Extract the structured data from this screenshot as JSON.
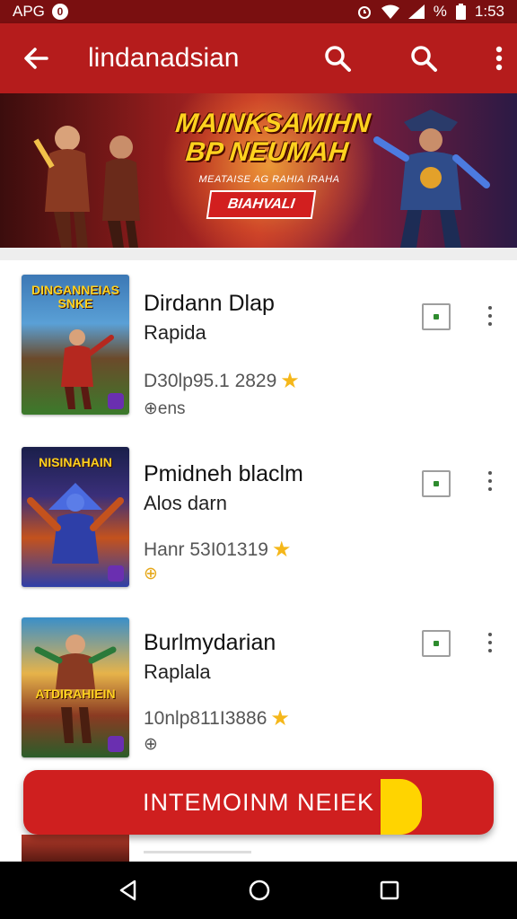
{
  "status_bar": {
    "carrier": "APG",
    "chip": "0",
    "battery": "%",
    "time": "1:53"
  },
  "app_bar": {
    "title": "lindanadsian",
    "back_icon": "arrow-left-icon",
    "search_icon": "search-icon",
    "more_icon": "more-vert-icon"
  },
  "banner": {
    "title_line1": "MAINKSAMIHN",
    "title_line2": "BP NEUMAH",
    "subtitle": "MEATAISE AG RAHIA IRAHA",
    "cta": "BIAHVALI"
  },
  "items": [
    {
      "thumb_caption": "DINGANNEIAS SNKE",
      "name": "Dirdann Dlap",
      "sub": "Rapida",
      "meta": "D30lp95.1 2829",
      "small": "⊕ens",
      "colors": [
        "#3c78b5",
        "#e1a634",
        "#3b7a2b"
      ]
    },
    {
      "thumb_caption": "NISINAHAIN",
      "name": "Pmidneh blaclm",
      "sub": "Alos darn",
      "meta": "Hanr 53I01319",
      "small": "⊕",
      "colors": [
        "#1a1f4a",
        "#c4521d",
        "#2e3fa8"
      ]
    },
    {
      "thumb_caption": "ATDIRAHIEIN",
      "name": "Burlmydarian",
      "sub": "Raplala",
      "meta": "10nlp811I3886",
      "small": "⊕",
      "colors": [
        "#3a8fc9",
        "#e6b34a",
        "#2b5d2a"
      ]
    }
  ],
  "cta_button": {
    "label": "INTEMOINM NEIEK"
  },
  "nav": {
    "back_icon": "nav-back-icon",
    "home_icon": "nav-home-icon",
    "recents_icon": "nav-recents-icon"
  },
  "theme": {
    "primary": "#b51c1c",
    "status": "#7a0f10",
    "accent": "#ffd400",
    "star": "#f5b71a"
  }
}
